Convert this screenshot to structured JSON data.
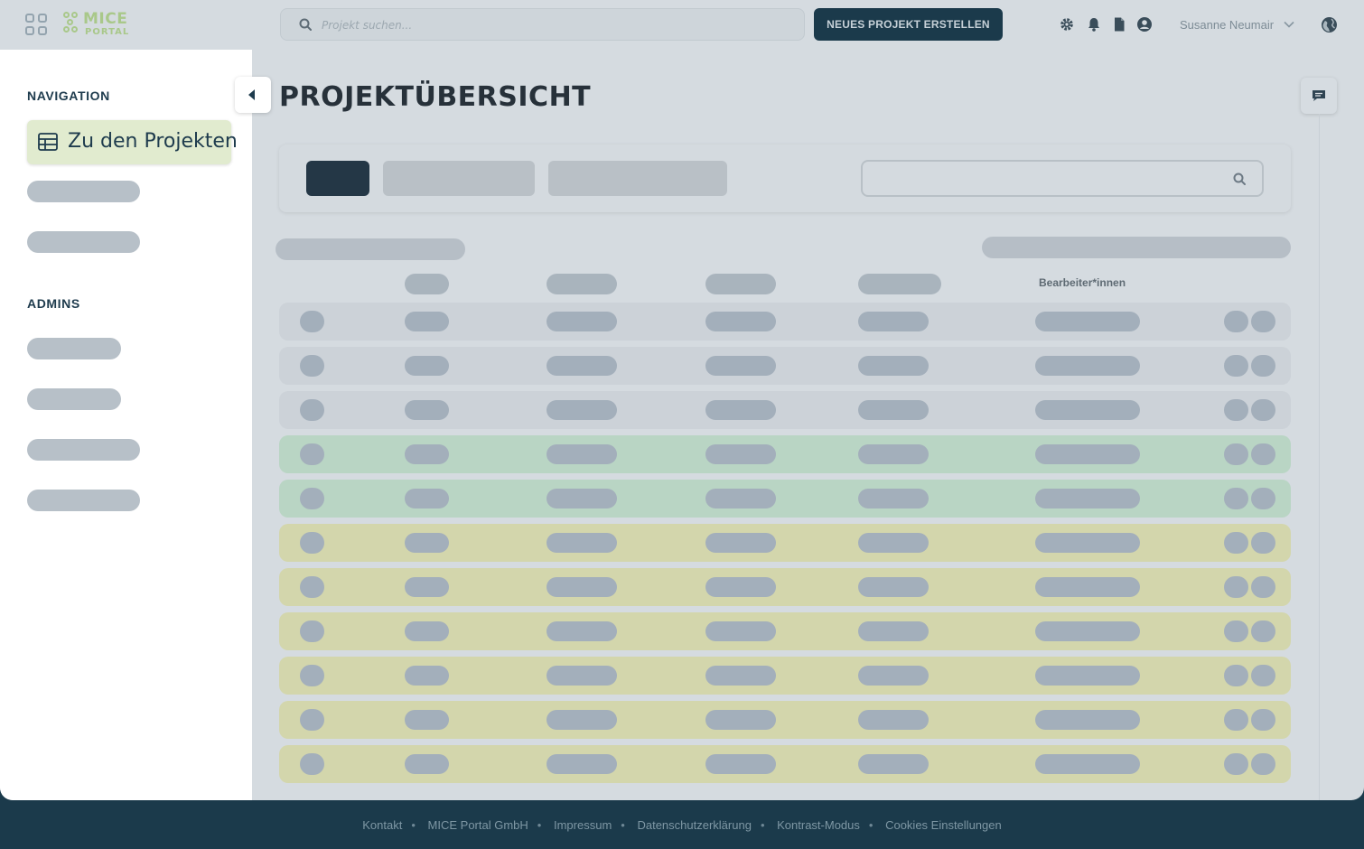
{
  "header": {
    "logo_line1": "MICE",
    "logo_line2": "PORTAL",
    "search_placeholder": "Projekt suchen...",
    "new_project_label": "NEUES PROJEKT ERSTELLEN",
    "user_name": "Susanne Neumair",
    "icons": [
      "apps-grid-icon",
      "gear-icon",
      "bell-icon",
      "document-icon",
      "user-circle-icon",
      "chevron-down-icon",
      "globe-icon"
    ]
  },
  "sidebar": {
    "navigation_heading": "NAVIGATION",
    "active_item_label": "Zu den Projekten",
    "admins_heading": "ADMINS"
  },
  "main": {
    "page_title": "PROJEKTÜBERSICHT",
    "column_header_editors": "Bearbeiter*innen",
    "row_colors": [
      "#ccd2d8",
      "#ccd2d8",
      "#ccd2d8",
      "#b9d5c4",
      "#b9d5c4",
      "#d3d6ac",
      "#d3d6ac",
      "#d3d6ac",
      "#d3d6ac",
      "#d3d6ac",
      "#d3d6ac"
    ]
  },
  "footer": {
    "links": [
      "Kontakt",
      "MICE Portal GmbH",
      "Impressum",
      "Datenschutzerklärung",
      "Kontrast-Modus",
      "Cookies Einstellungen"
    ]
  },
  "colors": {
    "brand_dark": "#1b3a4b",
    "brand_green": "#a9c88a",
    "active_nav_bg": "#e1ebcf"
  }
}
